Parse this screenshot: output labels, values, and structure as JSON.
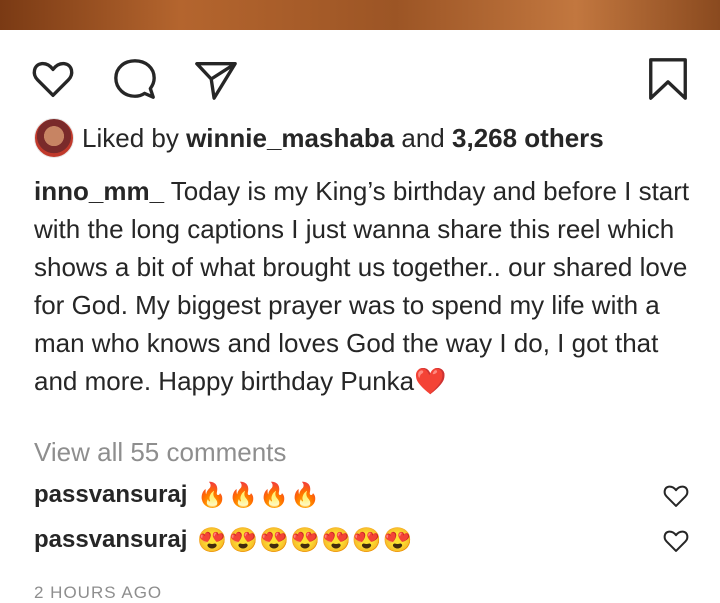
{
  "post": {
    "liked_by_prefix": "Liked by",
    "liked_by_user": "winnie_mashaba",
    "liked_by_and": "and",
    "liked_by_others": "3,268 others",
    "caption_user": "inno_mm_",
    "caption_text": "Today is my King’s birthday and before I start with the long captions I just wanna share this reel which shows a bit of what brought us together.. our shared love for God. My biggest prayer was to spend my life with a man who knows and loves God the way I do, I got that and more. Happy birthday Punka",
    "caption_emoji": "❤️",
    "view_comments": "View all 55 comments",
    "timestamp": "2 HOURS AGO"
  },
  "comments": [
    {
      "user": "passvansuraj",
      "text": "🔥🔥🔥🔥"
    },
    {
      "user": "passvansuraj",
      "text": "😍😍😍😍😍😍😍"
    }
  ],
  "icons": {
    "like": "heart-icon",
    "comment": "comment-bubble-icon",
    "share": "paper-plane-icon",
    "save": "bookmark-icon"
  }
}
